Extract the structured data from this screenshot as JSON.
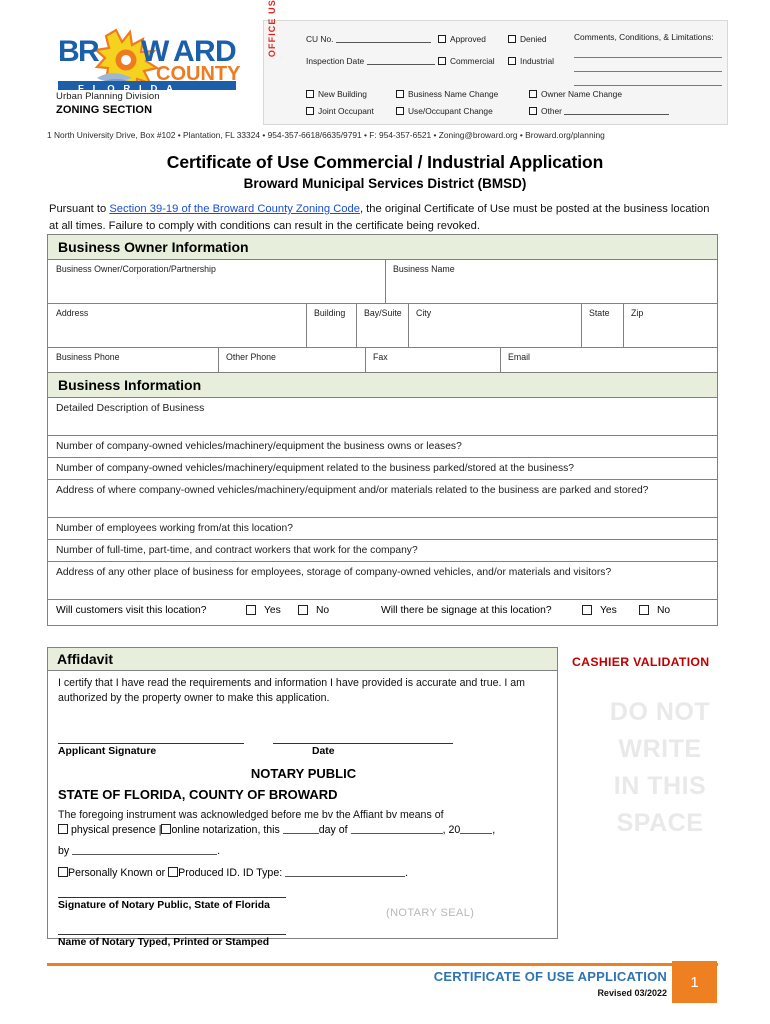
{
  "header": {
    "logo": {
      "word1": "BROWARD",
      "word2": "COUNTY",
      "word3": "FLORIDA",
      "sun_icon": "sun-icon"
    },
    "division": "Urban Planning Division",
    "section": "ZONING SECTION",
    "address_line": "1 North University Drive, Box #102 • Plantation, FL 33324 • 954-357-6618/6635/9791 • F: 954-357-6521 • Zoning@broward.org • Broward.org/planning"
  },
  "office_use": {
    "vertical_label": "OFFICE USE ONLY",
    "cu_no_label": "CU No.",
    "inspection_date_label": "Inspection Date",
    "approved": "Approved",
    "denied": "Denied",
    "commercial": "Commercial",
    "industrial": "Industrial",
    "comments_label": "Comments, Conditions, & Limitations:",
    "new_building": "New Building",
    "business_name_change": "Business Name Change",
    "owner_name_change": "Owner Name Change",
    "joint_occupant": "Joint Occupant",
    "use_occupant_change": "Use/Occupant Change",
    "other": "Other"
  },
  "titles": {
    "main": "Certificate of Use Commercial / Industrial Application",
    "sub": "Broward Municipal Services District (BMSD)"
  },
  "pursuant": {
    "pre": "Pursuant to ",
    "link": "Section 39-19 of the Broward County Zoning Code",
    "post": ", the original Certificate of Use must be posted at the business location at all times. Failure to comply with conditions can result in the certificate being revoked."
  },
  "business_owner": {
    "heading": "Business Owner Information",
    "owner_label": "Business Owner/Corporation/Partnership",
    "business_name_label": "Business Name",
    "address_label": "Address",
    "building_label": "Building",
    "bay_suite_label": "Bay/Suite",
    "city_label": "City",
    "state_label": "State",
    "zip_label": "Zip",
    "business_phone_label": "Business Phone",
    "other_phone_label": "Other Phone",
    "fax_label": "Fax",
    "email_label": "Email"
  },
  "business_info": {
    "heading": "Business Information",
    "description_label": "Detailed Description of Business",
    "questions": [
      "Number of company-owned vehicles/machinery/equipment the business owns or leases?",
      "Number of company-owned vehicles/machinery/equipment related to the business parked/stored at the business?",
      "Address of where company-owned vehicles/machinery/equipment and/or materials related to the business are parked and stored?",
      "Number of employees working from/at this location?",
      "Number of full-time, part-time, and contract workers that work for the company?",
      "Address of any other place of business for employees, storage of company-owned vehicles, and/or materials and visitors?"
    ],
    "customers_question": "Will customers visit this location?",
    "signage_question": "Will there be signage at this location?",
    "yes": "Yes",
    "no": "No"
  },
  "affidavit": {
    "heading": "Affidavit",
    "certify_text": "I certify that I have read the requirements and information I have provided is accurate and true. I am authorized by the property owner to make this application.",
    "applicant_signature_label": "Applicant Signature",
    "date_label": "Date",
    "notary_public": "NOTARY PUBLIC",
    "state_county": "STATE OF FLORIDA, COUNTY OF BROWARD",
    "foregoing": "The foregoing instrument was acknowledged before me bv the Affiant bv means of",
    "physical_presence": "physical presence |",
    "online_notarization": "online notarization, this",
    "day_of": "day of",
    "year_prefix": ", 20",
    "by_label": "by",
    "personally_known": "Personally Known or",
    "produced_id": "Produced ID.  ID Type:",
    "notary_sig_label": "Signature of Notary Public, State of Florida",
    "notary_name_label": "Name of Notary Typed, Printed or Stamped",
    "notary_seal": "(NOTARY SEAL)"
  },
  "cashier": {
    "title": "CASHIER  VALIDATION",
    "watermark_line1": "DO NOT",
    "watermark_line2": "WRITE",
    "watermark_line3": "IN THIS",
    "watermark_line4": "SPACE"
  },
  "footer": {
    "title": "CERTIFICATE OF USE APPLICATION",
    "revised": "Revised 03/2022",
    "page_number": "1"
  },
  "colors": {
    "logo_blue": "#1b5fab",
    "logo_orange": "#ee7b20",
    "section_header_bg": "#e8eedc",
    "office_red": "#e8231f",
    "cashier_red": "#c00000",
    "footer_orange": "#ee8022",
    "footer_blue": "#2e74b5",
    "link_blue": "#1b4fd8"
  }
}
